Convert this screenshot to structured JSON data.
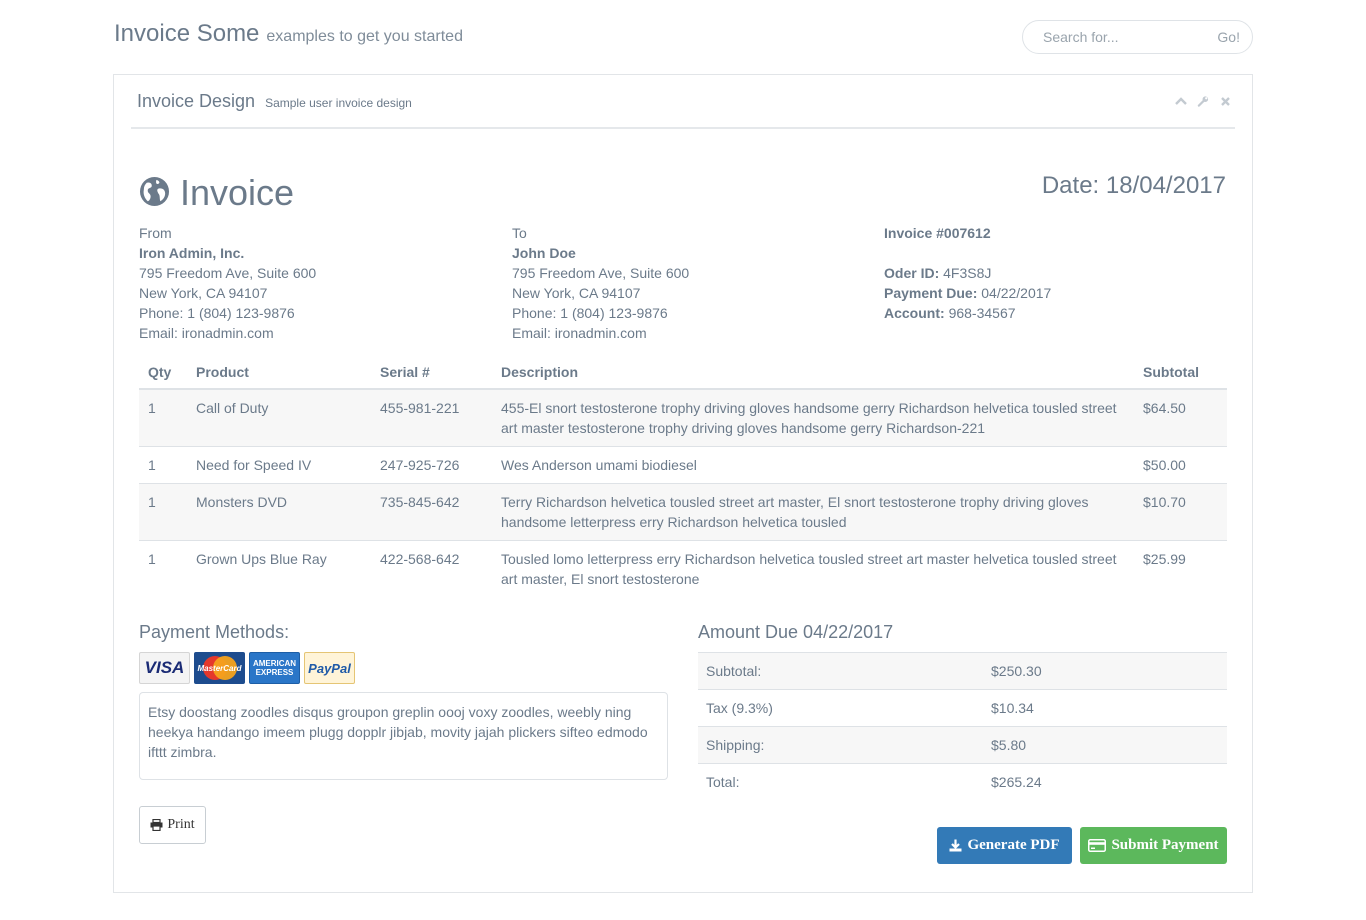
{
  "header": {
    "title": "Invoice Some",
    "subtitle": "examples to get you started",
    "search_placeholder": "Search for...",
    "search_go": "Go!"
  },
  "panel": {
    "title": "Invoice Design",
    "subtitle": "Sample user invoice design",
    "tools": [
      "chevron-up-icon",
      "wrench-icon",
      "close-icon"
    ]
  },
  "invoice": {
    "heading": "Invoice",
    "date": "Date: 18/04/2017",
    "from": {
      "label": "From",
      "name": "Iron Admin, Inc.",
      "street": "795 Freedom Ave, Suite 600",
      "city": "New York, CA 94107",
      "phone": "Phone: 1 (804) 123-9876",
      "email": "Email: ironadmin.com"
    },
    "to": {
      "label": "To",
      "name": "John Doe",
      "street": "795 Freedom Ave, Suite 600",
      "city": "New York, CA 94107",
      "phone": "Phone: 1 (804) 123-9876",
      "email": "Email: ironadmin.com"
    },
    "meta": {
      "invoice_number": "Invoice #007612",
      "order_label": "Oder ID:",
      "order_value": "4F3S8J",
      "payment_due_label": "Payment Due:",
      "payment_due_value": "04/22/2017",
      "account_label": "Account:",
      "account_value": "968-34567"
    }
  },
  "items": {
    "columns": [
      "Qty",
      "Product",
      "Serial #",
      "Description",
      "Subtotal"
    ],
    "rows": [
      {
        "qty": "1",
        "product": "Call of Duty",
        "serial": "455-981-221",
        "description": "455-El snort testosterone trophy driving gloves handsome gerry Richardson helvetica tousled street art master testosterone trophy driving gloves handsome gerry Richardson-221",
        "subtotal": "$64.50"
      },
      {
        "qty": "1",
        "product": "Need for Speed IV",
        "serial": "247-925-726",
        "description": "Wes Anderson umami biodiesel",
        "subtotal": "$50.00"
      },
      {
        "qty": "1",
        "product": "Monsters DVD",
        "serial": "735-845-642",
        "description": "Terry Richardson helvetica tousled street art master, El snort testosterone trophy driving gloves handsome letterpress erry Richardson helvetica tousled",
        "subtotal": "$10.70"
      },
      {
        "qty": "1",
        "product": "Grown Ups Blue Ray",
        "serial": "422-568-642",
        "description": "Tousled lomo letterpress erry Richardson helvetica tousled street art master helvetica tousled street art master, El snort testosterone",
        "subtotal": "$25.99"
      }
    ]
  },
  "payment": {
    "title": "Payment Methods:",
    "cards": {
      "visa": "VISA",
      "mastercard": "MasterCard",
      "amex_line1": "AMERICAN",
      "amex_line2": "EXPRESS",
      "paypal": "PayPal"
    },
    "note": "Etsy doostang zoodles disqus groupon greplin oooj voxy zoodles, weebly ning heekya handango imeem plugg dopplr jibjab, movity jajah plickers sifteo edmodo ifttt zimbra."
  },
  "amount_due": {
    "title": "Amount Due 04/22/2017",
    "rows": [
      {
        "label": "Subtotal:",
        "value": "$250.30"
      },
      {
        "label": "Tax (9.3%)",
        "value": "$10.34"
      },
      {
        "label": "Shipping:",
        "value": "$5.80"
      },
      {
        "label": "Total:",
        "value": "$265.24"
      }
    ]
  },
  "actions": {
    "print": "Print",
    "generate_pdf": "Generate PDF",
    "submit_payment": "Submit Payment"
  },
  "colors": {
    "primary": "#337ab7",
    "success": "#5cb85c",
    "text": "#6b7a8a"
  }
}
